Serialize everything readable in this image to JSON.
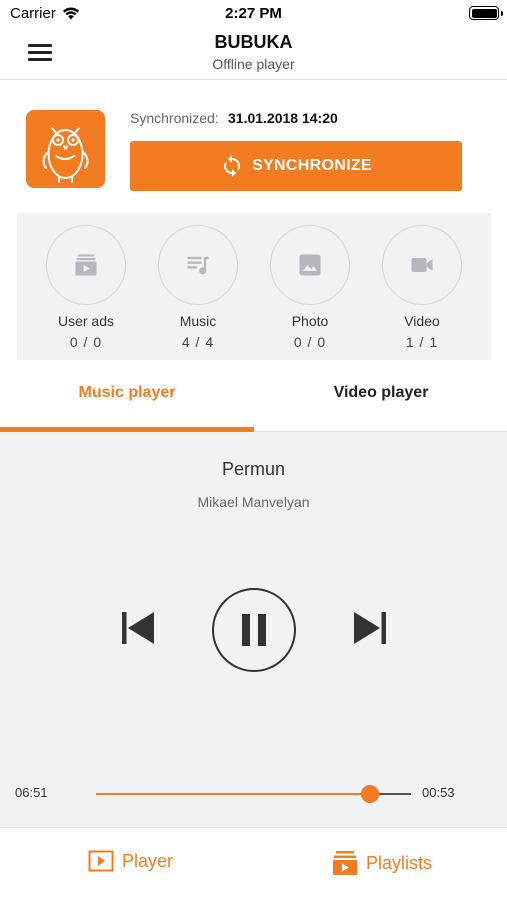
{
  "status_bar": {
    "carrier": "Carrier",
    "time": "2:27 PM"
  },
  "header": {
    "title": "BUBUKA",
    "subtitle": "Offline player"
  },
  "sync": {
    "label": "Synchronized:",
    "datetime": "31.01.2018 14:20",
    "button_label": "SYNCHRONIZE"
  },
  "counts": [
    {
      "label": "User ads",
      "value": "0 / 0",
      "icon": "video-library-icon"
    },
    {
      "label": "Music",
      "value": "4 / 4",
      "icon": "queue-music-icon"
    },
    {
      "label": "Photo",
      "value": "0 / 0",
      "icon": "image-icon"
    },
    {
      "label": "Video",
      "value": "1 / 1",
      "icon": "videocam-icon"
    }
  ],
  "tabs": [
    {
      "label": "Music player",
      "active": true
    },
    {
      "label": "Video player",
      "active": false
    }
  ],
  "player": {
    "title": "Permun",
    "artist": "Mikael Manvelyan",
    "elapsed": "06:51",
    "remaining": "00:53",
    "progress": 0.87
  },
  "bottom_nav": {
    "player_label": "Player",
    "playlists_label": "Playlists"
  },
  "colors": {
    "accent": "#f47c20",
    "panel": "#f1f2f4",
    "icon_gray": "#b4b8bd"
  }
}
